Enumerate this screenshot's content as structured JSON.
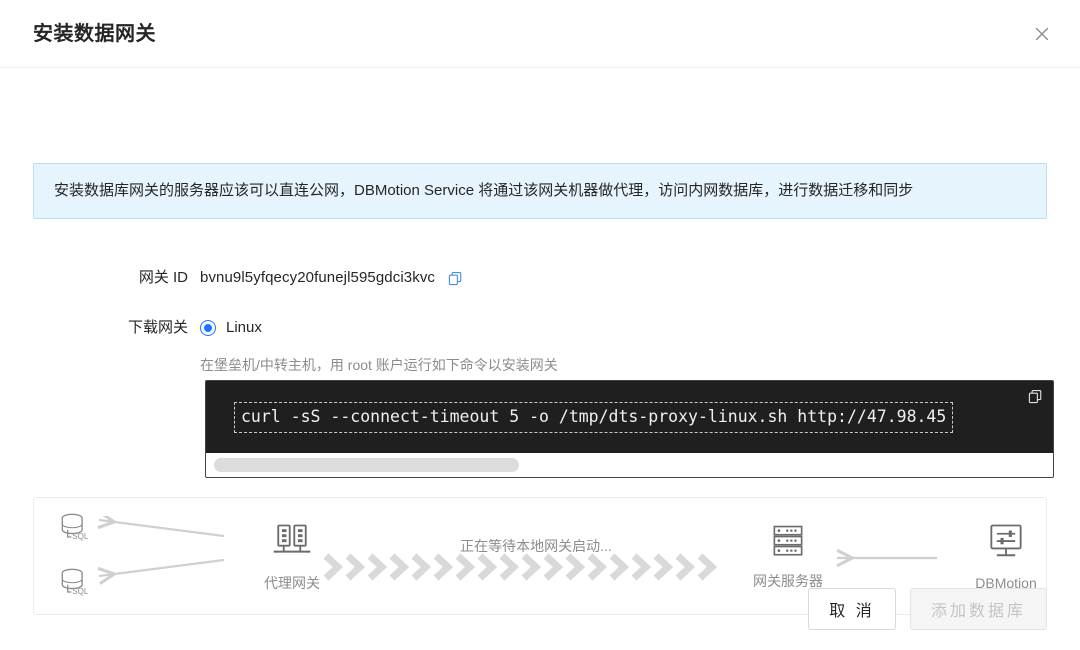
{
  "dialog": {
    "title": "安装数据网关",
    "close_icon": "close-icon"
  },
  "info_banner": {
    "text": "安装数据库网关的服务器应该可以直连公网，DBMotion Service 将通过该网关机器做代理，访问内网数据库，进行数据迁移和同步"
  },
  "form": {
    "gateway_id": {
      "label": "网关 ID",
      "value": "bvnu9l5yfqecy20funejl595gdci3kvc",
      "copy_icon": "copy-icon"
    },
    "download": {
      "label": "下载网关",
      "selected": "Linux",
      "options": [
        "Linux"
      ],
      "hint": "在堡垒机/中转主机，用 root 账户运行如下命令以安装网关"
    }
  },
  "terminal": {
    "command": "curl -sS --connect-timeout 5 -o /tmp/dts-proxy-linux.sh http://47.98.45",
    "copy_icon": "copy-icon",
    "scrollbar_thumb_percent": 36
  },
  "diagram": {
    "status_text": "正在等待本地网关启动...",
    "nodes": [
      {
        "id": "database-1",
        "icon": "sql-database-icon",
        "label": ""
      },
      {
        "id": "database-2",
        "icon": "sql-database-icon",
        "label": ""
      },
      {
        "id": "proxy-gateway",
        "icon": "proxy-gateway-icon",
        "label": "代理网关"
      },
      {
        "id": "gateway-server",
        "icon": "server-rack-icon",
        "label": "网关服务器"
      },
      {
        "id": "dbmotion",
        "icon": "monitor-settings-icon",
        "label": "DBMotion"
      }
    ]
  },
  "footer": {
    "cancel_label": "取 消",
    "submit_label": "添加数据库",
    "submit_disabled": true
  },
  "colors": {
    "accent": "#1677ff",
    "banner_bg": "#e6f4fd",
    "banner_border": "#b8e0f7",
    "terminal_bg": "#1f1f1f",
    "muted_text": "#8c8c8c",
    "chevron": "#d9d9d9"
  }
}
